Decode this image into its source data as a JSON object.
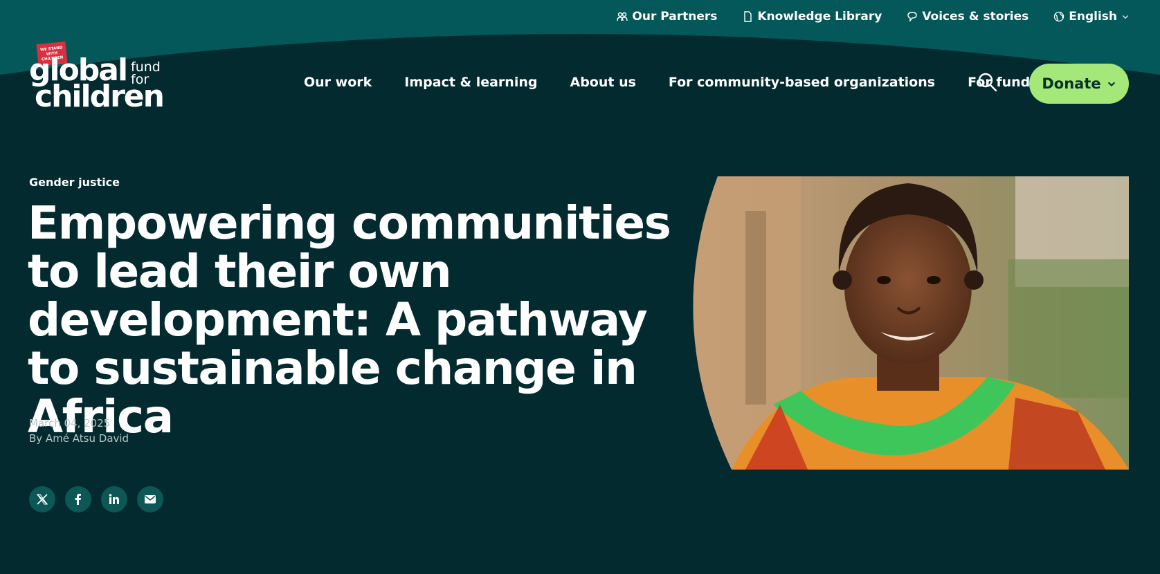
{
  "utility_nav": {
    "partners": "Our Partners",
    "library": "Knowledge Library",
    "voices": "Voices & stories",
    "language": "English"
  },
  "logo": {
    "badge": "WE STAND WITH CHILDREN",
    "word1": "global",
    "word2": "fund for",
    "word3": "children"
  },
  "main_nav": {
    "our_work": "Our work",
    "impact": "Impact & learning",
    "about": "About us",
    "cbo": "For community-based organizations",
    "funders": "For funders"
  },
  "donate": {
    "label": "Donate"
  },
  "article": {
    "category": "Gender justice",
    "title": "Empowering communities to lead their own development: A pathway to sustainable change in Africa",
    "date": "March 04, 2025",
    "byline": "By Amé Atsu David"
  },
  "share": [
    "x-icon",
    "facebook-icon",
    "linkedin-icon",
    "email-icon"
  ],
  "colors": {
    "background": "#032b2f",
    "top_band": "#04585a",
    "donate": "#a4e87a",
    "share_bg": "#0d5756",
    "logo_red": "#d8303f"
  }
}
